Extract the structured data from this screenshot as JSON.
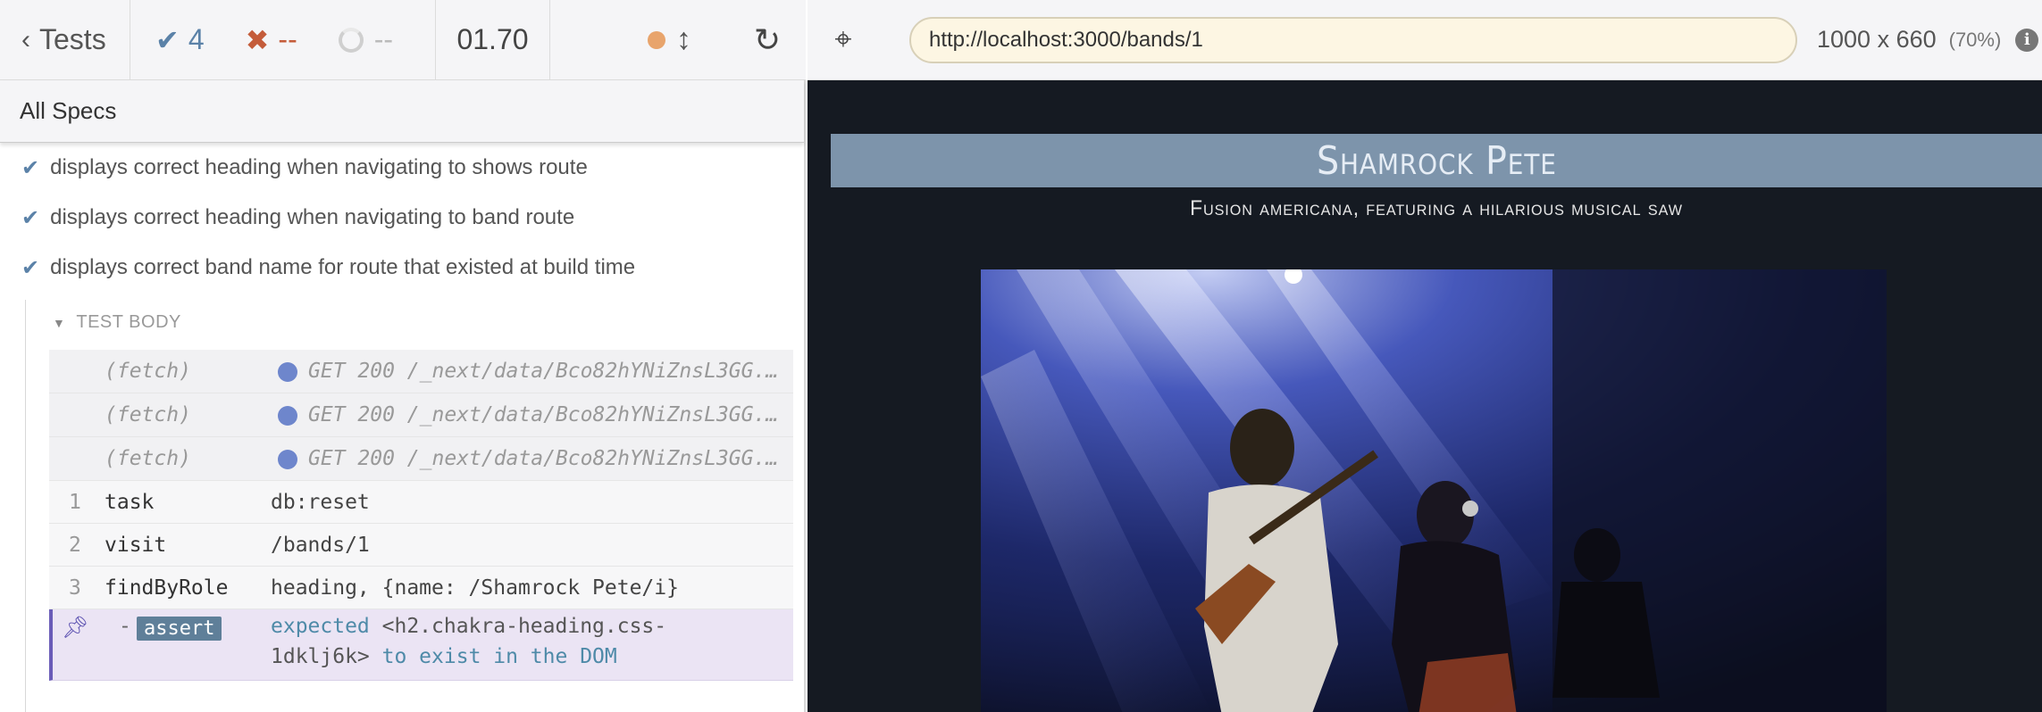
{
  "reporter": {
    "nav": {
      "back_label": "Tests"
    },
    "stats": {
      "passed": "4",
      "failed": "--",
      "pending": "--",
      "duration": "01.70"
    },
    "all_specs_label": "All Specs",
    "tests": [
      "displays correct heading when navigating to shows route",
      "displays correct heading when navigating to band route",
      "displays correct band name for route that existed at build time"
    ],
    "test_body_label": "TEST BODY",
    "events": [
      {
        "name": "(fetch)",
        "message": "GET 200 /_next/data/Bco82hYNiZnsL3GG..."
      },
      {
        "name": "(fetch)",
        "message": "GET 200 /_next/data/Bco82hYNiZnsL3GG..."
      },
      {
        "name": "(fetch)",
        "message": "GET 200 /_next/data/Bco82hYNiZnsL3GG..."
      }
    ],
    "commands": [
      {
        "num": "1",
        "name": "task",
        "message": "db:reset"
      },
      {
        "num": "2",
        "name": "visit",
        "message": "/bands/1"
      },
      {
        "num": "3",
        "name": "findByRole",
        "message": "heading, {name: /Shamrock Pete/i}"
      }
    ],
    "assertion": {
      "dash": "-",
      "badge": "assert",
      "expected": "expected",
      "selector_part1": "<h2.chakra-heading.css-",
      "selector_part2": "1dklj6k>",
      "tail": "to exist in the DOM"
    }
  },
  "aut": {
    "url": "http://localhost:3000/bands/1",
    "viewport_size": "1000 x 660",
    "viewport_scale": "(70%)",
    "info_glyph": "i",
    "page": {
      "band_name": "Shamrock Pete",
      "band_description": "Fusion americana, featuring a hilarious musical saw"
    }
  },
  "colors": {
    "pass": "#5b82a8",
    "fail": "#c45c3a",
    "banner": "#7d94ab",
    "aut_bg": "#151a22",
    "assert_bg": "#ebe4f4"
  }
}
